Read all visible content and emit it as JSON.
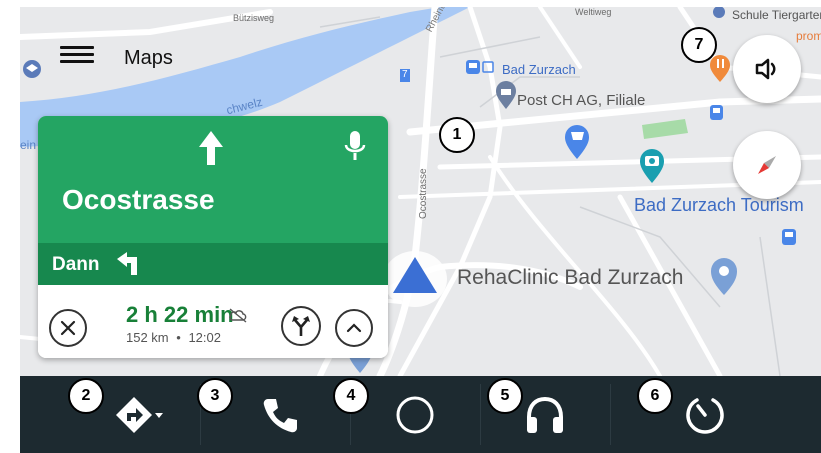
{
  "app": {
    "title": "Maps"
  },
  "map": {
    "labels": {
      "buetzisweg": "Bützisweg",
      "weltiweg": "Weltiweg",
      "schule": "Schule Tiergarten",
      "promo": "proma",
      "rhein_top": "Rheinta",
      "rhein_left": "ein",
      "schwelz": "chwelz",
      "bad_zurzach": "Bad Zurzach",
      "post": "Post CH AG, Filiale",
      "ocostrasse_road": "Ocostrasse",
      "tourism": "Bad Zurzach Tourism",
      "rehaclinic": "RehaClinic Bad Zurzach",
      "route_num": "7"
    }
  },
  "navigation": {
    "street": "Ocostrasse",
    "then_label": "Dann",
    "eta_hours": "2 h",
    "eta_minutes": "22 min",
    "distance": "152 km",
    "separator": "•",
    "arrival_time": "12:02"
  },
  "badges": [
    "1",
    "2",
    "3",
    "4",
    "5",
    "6",
    "7"
  ],
  "dock": {
    "items": [
      "navigation",
      "phone",
      "home",
      "audio",
      "notifications"
    ]
  },
  "colors": {
    "nav_green": "#24a563",
    "nav_green_dark": "#17884e",
    "dock_bg": "#1d2a30",
    "water": "#a9c9f5",
    "poi_blue": "#4a86e8"
  }
}
